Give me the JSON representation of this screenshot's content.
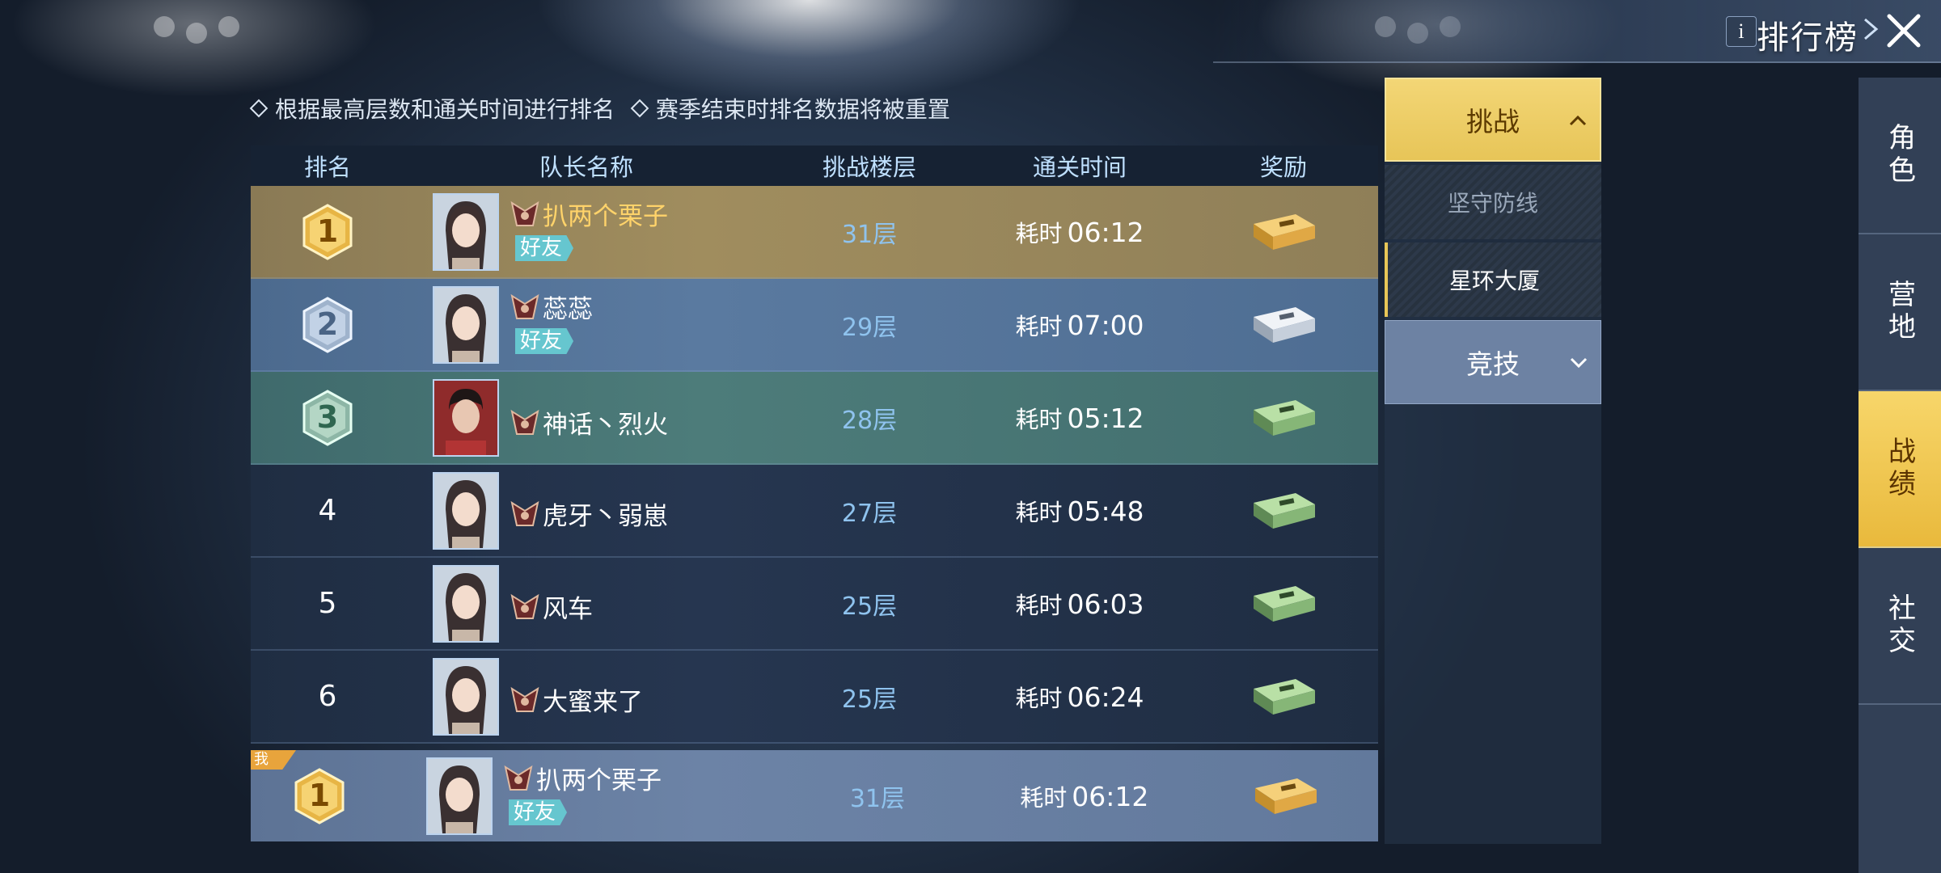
{
  "header": {
    "title": "排行榜",
    "info_label": "i"
  },
  "hints": [
    "根据最高层数和通关时间进行排名",
    "赛季结束时排名数据将被重置"
  ],
  "table": {
    "columns": {
      "rank": "排名",
      "leader": "队长名称",
      "floor": "挑战楼层",
      "time": "通关时间",
      "reward": "奖励"
    },
    "rows": [
      {
        "rank": "1",
        "name": "扒两个栗子",
        "friend": "好友",
        "floor": "31层",
        "time_label": "耗时",
        "time": "06:12",
        "reward_icon": "gold-chest-icon"
      },
      {
        "rank": "2",
        "name": "蕊蕊",
        "friend": "好友",
        "floor": "29层",
        "time_label": "耗时",
        "time": "07:00",
        "reward_icon": "silver-chest-icon"
      },
      {
        "rank": "3",
        "name": "神话丶烈火",
        "friend": "",
        "floor": "28层",
        "time_label": "耗时",
        "time": "05:12",
        "reward_icon": "green-chest-icon"
      },
      {
        "rank": "4",
        "name": "虎牙丶弱崽",
        "friend": "",
        "floor": "27层",
        "time_label": "耗时",
        "time": "05:48",
        "reward_icon": "green-chest-icon"
      },
      {
        "rank": "5",
        "name": "风车",
        "friend": "",
        "floor": "25层",
        "time_label": "耗时",
        "time": "06:03",
        "reward_icon": "green-chest-icon"
      },
      {
        "rank": "6",
        "name": "大蜜来了",
        "friend": "",
        "floor": "25层",
        "time_label": "耗时",
        "time": "06:24",
        "reward_icon": "green-chest-icon"
      }
    ],
    "me": {
      "tag": "我",
      "rank": "1",
      "name": "扒两个栗子",
      "friend": "好友",
      "floor": "31层",
      "time_label": "耗时",
      "time": "06:12",
      "reward_icon": "gold-chest-icon"
    }
  },
  "category_panel": {
    "group1": {
      "label": "挑战",
      "expanded": true
    },
    "sub_items": [
      {
        "label": "坚守防线",
        "active": false
      },
      {
        "label": "星环大厦",
        "active": true
      }
    ],
    "group2": {
      "label": "竞技",
      "expanded": false
    }
  },
  "side_nav": [
    {
      "label": "角色",
      "active": false
    },
    {
      "label": "营地",
      "active": false
    },
    {
      "label": "战绩",
      "active": true
    },
    {
      "label": "社交",
      "active": false
    }
  ],
  "colors": {
    "accent_gold": "#f3d676",
    "floor_text": "#8fc3ee",
    "friend_badge": "#66c6cf"
  }
}
